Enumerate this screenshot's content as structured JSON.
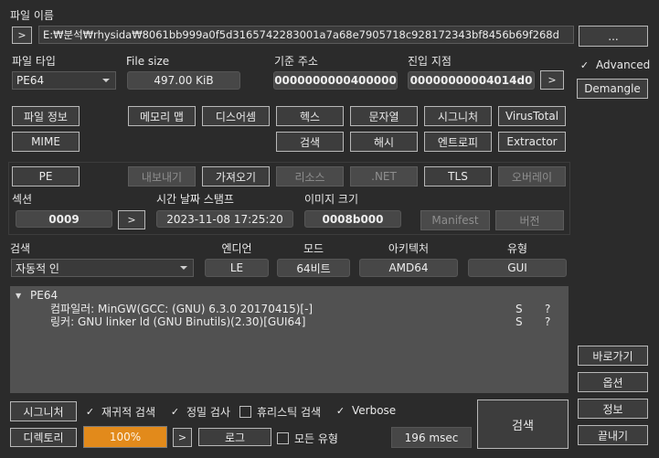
{
  "file_name": {
    "label": "파일 이름",
    "path": "E:₩분석₩rhysida₩8061bb999a0f5d3165742283001a7a68e7905718c928172343bf8456b69f268d",
    "browse_label": "..."
  },
  "file_type": {
    "label": "파일 타입",
    "value": "PE64"
  },
  "file_size": {
    "label": "File size",
    "value": "497.00 KiB"
  },
  "base_address": {
    "label": "기준 주소",
    "value": "0000000000400000"
  },
  "entry_point": {
    "label": "진입 지점",
    "value": "00000000004014d0"
  },
  "advanced": {
    "label": "Advanced",
    "checked": true
  },
  "demangle_label": "Demangle",
  "buttons": {
    "file_info": "파일 정보",
    "memory_map": "메모리 맵",
    "disasm": "디스어셈",
    "hex": "헥스",
    "strings": "문자열",
    "signature": "시그니처",
    "virustotal": "VirusTotal",
    "mime": "MIME",
    "search": "검색",
    "hash": "해시",
    "entropy": "엔트로피",
    "extractor": "Extractor"
  },
  "pe_tabs": {
    "pe": "PE",
    "export": "내보내기",
    "import": "가져오기",
    "resource": "리소스",
    "dotnet": ".NET",
    "tls": "TLS",
    "overlay": "오버레이"
  },
  "section": {
    "label": "섹션",
    "value": "0009"
  },
  "timestamp": {
    "label": "시간 날짜 스탬프",
    "value": "2023-11-08 17:25:20"
  },
  "image_size": {
    "label": "이미지 크기",
    "value": "0008b000"
  },
  "manifest_label": "Manifest",
  "version_label": "버전",
  "scan": {
    "label": "검색",
    "mode_value": "자동적 인",
    "endian_label": "엔디언",
    "endian_value": "LE",
    "mode_label": "모드",
    "bits_value": "64비트",
    "arch_label": "아키텍처",
    "arch_value": "AMD64",
    "type_label": "유형",
    "type_value": "GUI"
  },
  "results": {
    "root": "PE64",
    "items": [
      {
        "text": "컴파일러: MinGW(GCC: (GNU) 6.3.0 20170415)[-]",
        "flag": "S",
        "q": "?"
      },
      {
        "text": "링커: GNU linker ld (GNU Binutils)(2.30)[GUI64]",
        "flag": "S",
        "q": "?"
      }
    ]
  },
  "side": {
    "shortcut": "바로가기",
    "options": "옵션",
    "about": "정보",
    "exit": "끝내기"
  },
  "bottom": {
    "signature_btn": "시그니처",
    "recursive": "재귀적 검색",
    "deep": "정밀 검사",
    "heuristic": "휴리스틱 검색",
    "verbose": "Verbose",
    "directory_btn": "디렉토리",
    "progress": "100%",
    "progress_fraction": 1.0,
    "log_btn": "로그",
    "all_types": "모든 유형",
    "elapsed": "196 msec",
    "scan_btn": "검색"
  },
  "colors": {
    "progress": "#e28a1b",
    "background": "#2b2b2b"
  }
}
